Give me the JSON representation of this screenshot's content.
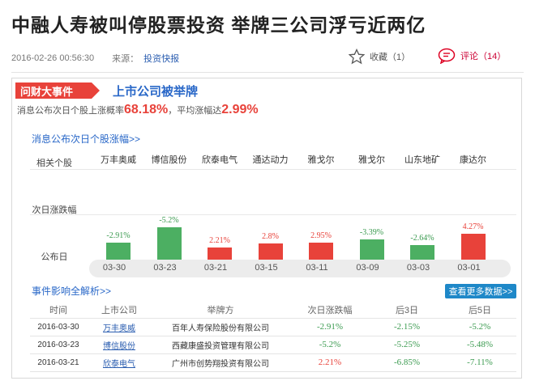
{
  "headline": "中融人寿被叫停股票投资 举牌三公司浮亏近两亿",
  "meta": {
    "time": "2016-02-26 00:56:30",
    "source_label": "来源：",
    "source_link": "投资快报"
  },
  "favorite": {
    "label": "收藏（1）"
  },
  "comments": {
    "label": "评论（14）"
  },
  "panel": {
    "tag": "问财大事件",
    "title": "上市公司被举牌",
    "stats_prefix": "消息公布次日个股上涨概率",
    "stats_prob": "68.18%",
    "stats_mid": "，平均涨幅达",
    "stats_avg": "2.99%",
    "chart_link": "消息公布次日个股涨幅>>",
    "row_labels": {
      "stock": "相关个股",
      "change": "次日涨跌幅",
      "date": "公布日"
    }
  },
  "chart_data": {
    "type": "bar",
    "categories": [
      "万丰奥威",
      "博信股份",
      "欣泰电气",
      "通达动力",
      "雅戈尔",
      "雅戈尔",
      "山东地矿",
      "康达尔"
    ],
    "dates": [
      "03-30",
      "03-23",
      "03-21",
      "03-15",
      "03-11",
      "03-09",
      "03-03",
      "03-01"
    ],
    "labels": [
      "-2.91%",
      "-5.2%",
      "2.21%",
      "2.8%",
      "2.95%",
      "-3.39%",
      "-2.64%",
      "4.27%"
    ],
    "values": [
      -2.91,
      -5.2,
      2.21,
      2.8,
      2.95,
      -3.39,
      -2.64,
      4.27
    ],
    "colors": {
      "up": "#e8423a",
      "down": "#4caf62"
    }
  },
  "impact_link": "事件影响全解析>>",
  "more_button": "查看更多数据>>",
  "table": {
    "headers": [
      "时间",
      "上市公司",
      "举牌方",
      "次日涨跌幅",
      "后3日",
      "后5日"
    ],
    "rows": [
      [
        "2016-03-30",
        "万丰奥威",
        "百年人寿保险股份有限公司",
        "-2.91%",
        "-2.15%",
        "-5.2%"
      ],
      [
        "2016-03-23",
        "博信股份",
        "西藏康盛投资管理有限公司",
        "-5.2%",
        "-5.25%",
        "-5.48%"
      ],
      [
        "2016-03-21",
        "欣泰电气",
        "广州市创势翔投资有限公司",
        "2.21%",
        "-6.85%",
        "-7.11%"
      ]
    ]
  }
}
